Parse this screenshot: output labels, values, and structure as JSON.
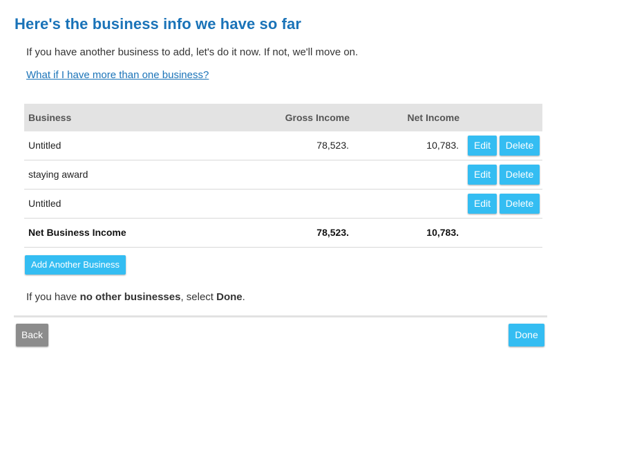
{
  "page": {
    "title": "Here's the business info we have so far",
    "intro": "If you have another business to add, let's do it now. If not, we'll move on.",
    "help_link": "What if I have more than one business?"
  },
  "table": {
    "headers": {
      "business": "Business",
      "gross": "Gross Income",
      "net": "Net Income"
    },
    "rows": [
      {
        "name": "Untitled",
        "gross": "78,523.",
        "net": "10,783.",
        "edit": "Edit",
        "delete": "Delete"
      },
      {
        "name": "staying award",
        "gross": "",
        "net": "",
        "edit": "Edit",
        "delete": "Delete"
      },
      {
        "name": "Untitled",
        "gross": "",
        "net": "",
        "edit": "Edit",
        "delete": "Delete"
      }
    ],
    "total": {
      "label": "Net Business Income",
      "gross": "78,523.",
      "net": "10,783."
    }
  },
  "actions": {
    "add_another": "Add Another Business",
    "done_note": {
      "prefix": "If you have ",
      "emphasis": "no other businesses",
      "middle": ", select ",
      "done_word": "Done",
      "suffix": "."
    },
    "back": "Back",
    "done": "Done"
  },
  "colors": {
    "title": "#1a73b8",
    "link": "#1a73b8",
    "primary_button": "#34bdf2",
    "secondary_button": "#8c8c8c",
    "header_bg": "#e3e3e3"
  }
}
